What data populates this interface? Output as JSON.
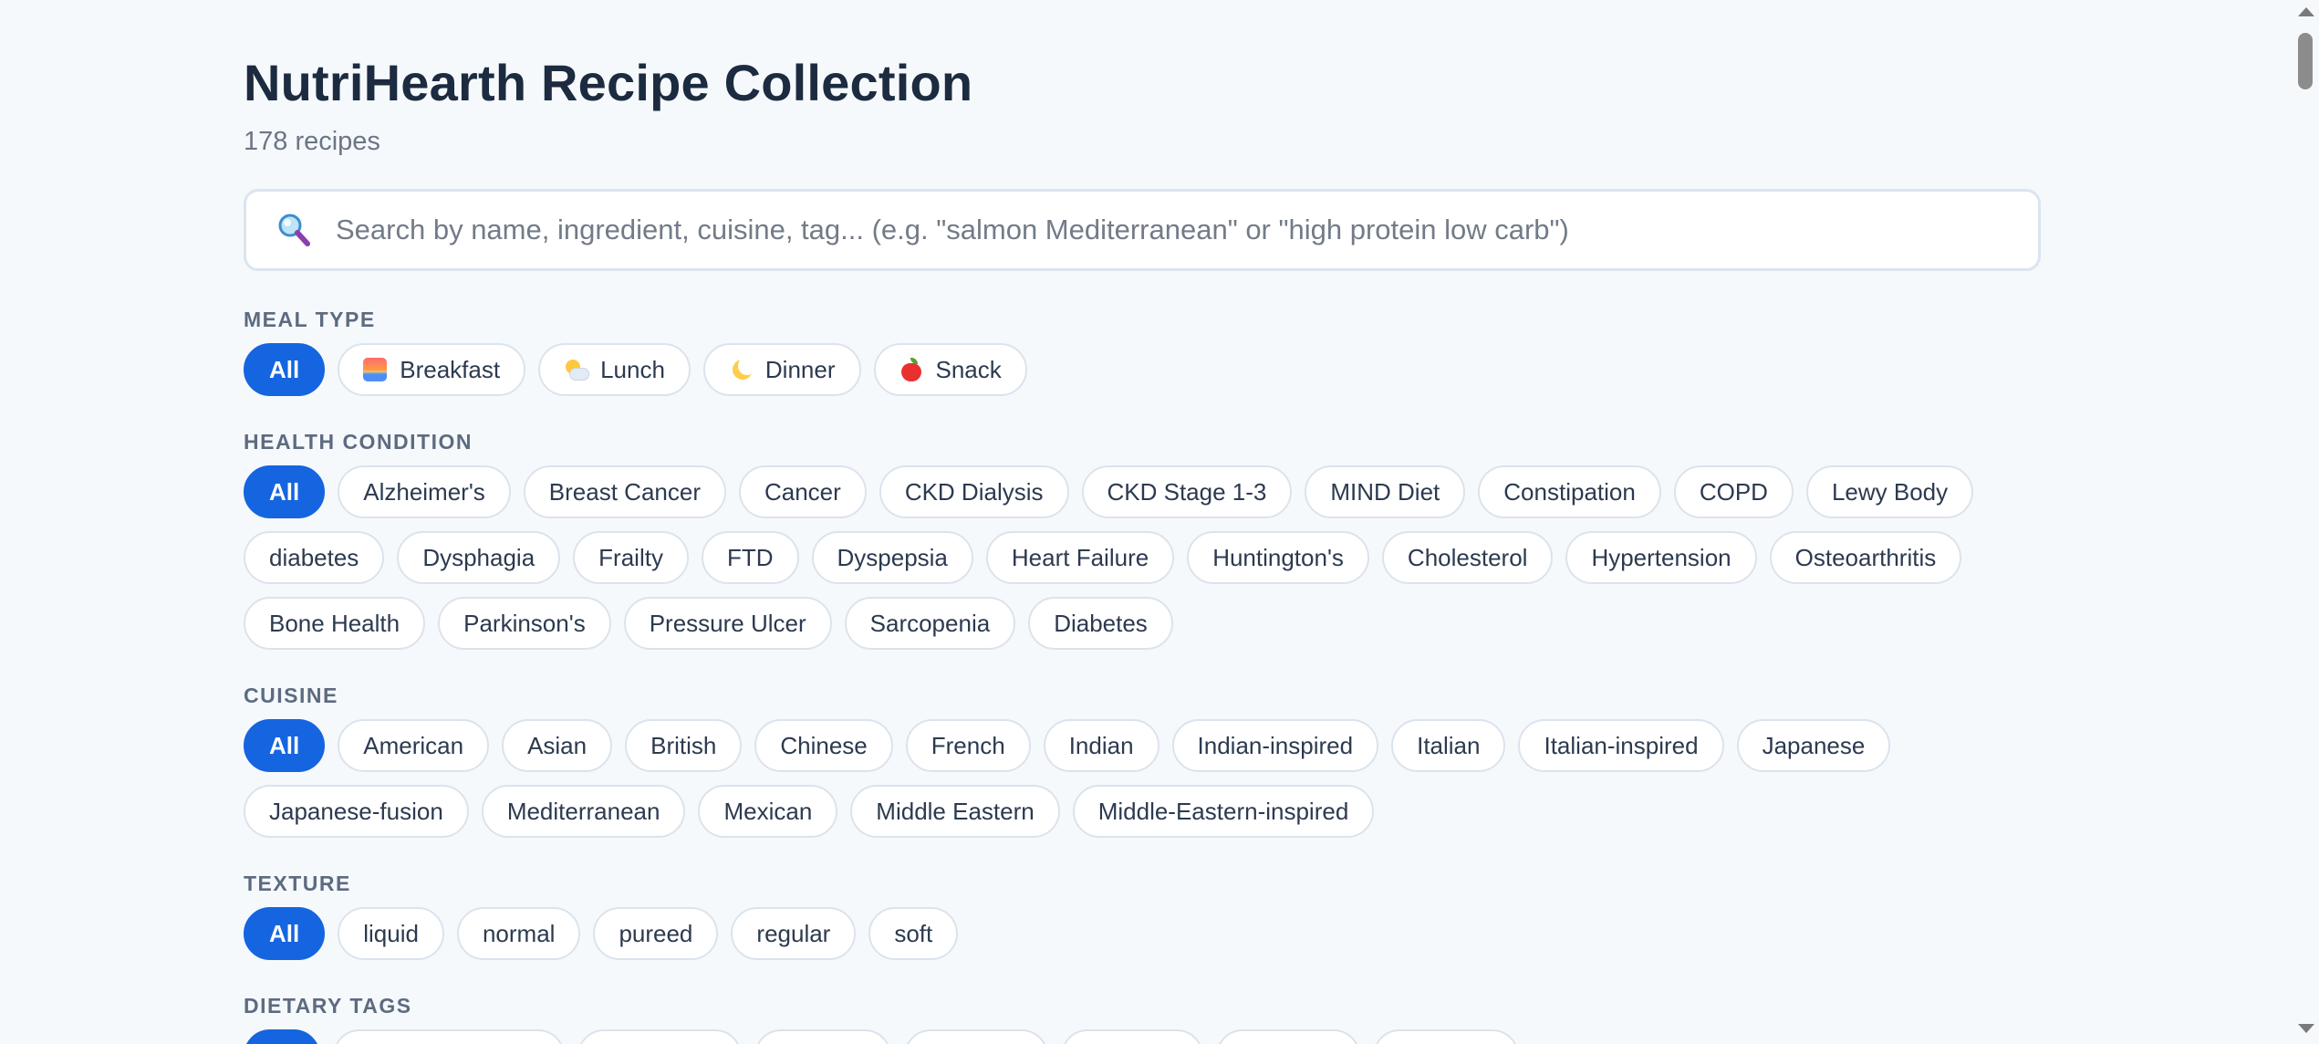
{
  "header": {
    "title": "NutriHearth Recipe Collection",
    "count": "178 recipes"
  },
  "search": {
    "placeholder": "Search by name, ingredient, cuisine, tag... (e.g. \"salmon Mediterranean\" or \"high protein low carb\")",
    "icon": "magnifying-glass-icon"
  },
  "meal_type": {
    "label": "MEAL TYPE",
    "options": [
      {
        "label": "All",
        "active": true
      },
      {
        "label": "Breakfast",
        "icon": "sunrise-icon"
      },
      {
        "label": "Lunch",
        "icon": "sun-behind-cloud-icon"
      },
      {
        "label": "Dinner",
        "icon": "crescent-moon-icon"
      },
      {
        "label": "Snack",
        "icon": "red-apple-icon"
      }
    ]
  },
  "health_condition": {
    "label": "HEALTH CONDITION",
    "options": [
      "All",
      "Alzheimer's",
      "Breast Cancer",
      "Cancer",
      "CKD Dialysis",
      "CKD Stage 1-3",
      "MIND Diet",
      "Constipation",
      "COPD",
      "Lewy Body",
      "diabetes",
      "Dysphagia",
      "Frailty",
      "FTD",
      "Dyspepsia",
      "Heart Failure",
      "Huntington's",
      "Cholesterol",
      "Hypertension",
      "Osteoarthritis",
      "Bone Health",
      "Parkinson's",
      "Pressure Ulcer",
      "Sarcopenia",
      "Diabetes"
    ]
  },
  "cuisine": {
    "label": "CUISINE",
    "options": [
      "All",
      "American",
      "Asian",
      "British",
      "Chinese",
      "French",
      "Indian",
      "Indian-inspired",
      "Italian",
      "Italian-inspired",
      "Japanese",
      "Japanese-fusion",
      "Mediterranean",
      "Mexican",
      "Middle Eastern",
      "Middle-Eastern-inspired"
    ]
  },
  "texture": {
    "label": "TEXTURE",
    "options": [
      "All",
      "liquid",
      "normal",
      "pureed",
      "regular",
      "soft"
    ]
  },
  "dietary_tags": {
    "label": "DIETARY TAGS"
  },
  "colors": {
    "accent": "#1565e0",
    "background": "#f6f9fc",
    "chip_border": "#dbe3ec"
  }
}
